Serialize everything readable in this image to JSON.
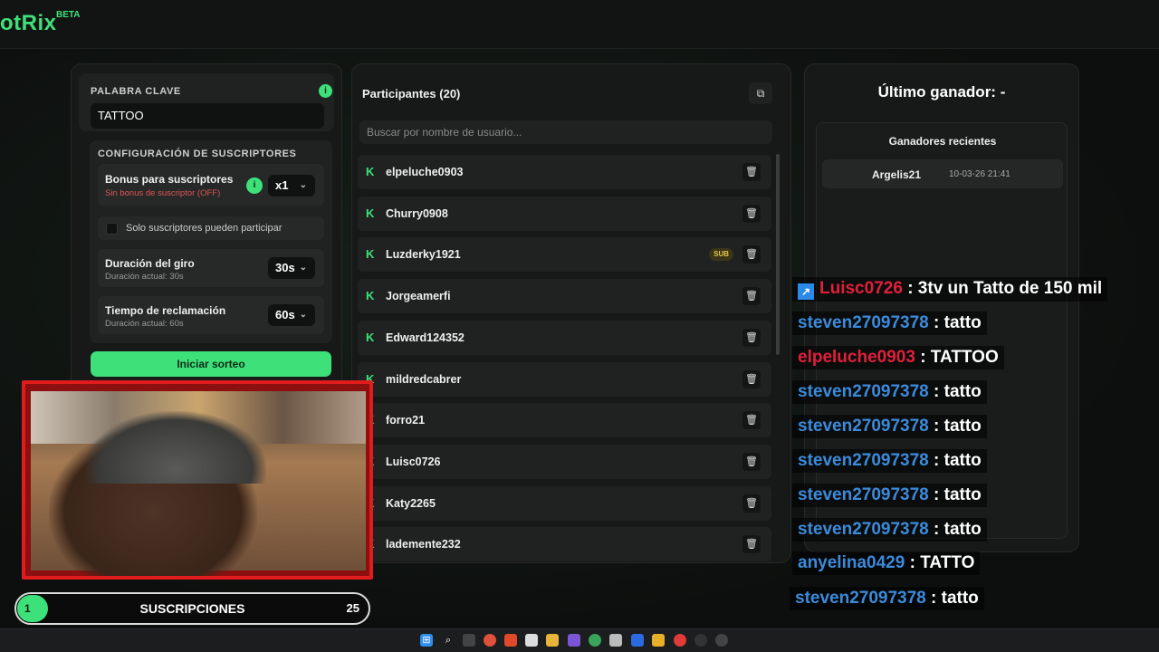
{
  "app": {
    "brand": "otRix",
    "badge": "BETA"
  },
  "keyword": {
    "label": "PALABRA CLAVE",
    "value": "TATTOO"
  },
  "subs_config": {
    "header": "CONFIGURACIÓN DE SUSCRIPTORES",
    "bonus_title": "Bonus para suscriptores",
    "bonus_sub": "Sin bonus de suscriptor (OFF)",
    "bonus_value": "x1",
    "only_subs": "Solo suscriptores pueden participar",
    "spin_title": "Duración del giro",
    "spin_sub": "Duración actual: 30s",
    "spin_value": "30s",
    "claim_title": "Tiempo de reclamación",
    "claim_sub": "Duración actual: 60s",
    "claim_value": "60s"
  },
  "start_button": "Iniciar sorteo",
  "participants": {
    "title": "Participantes (20)",
    "search_placeholder": "Buscar por nombre de usuario...",
    "sub_badge": "SUB",
    "items": [
      {
        "name": "elpeluche0903"
      },
      {
        "name": "Churry0908"
      },
      {
        "name": "Luzderky1921",
        "sub": true
      },
      {
        "name": "Jorgeamerfi"
      },
      {
        "name": "Edward124352"
      },
      {
        "name": "mildredcabrer"
      },
      {
        "name": "forro21"
      },
      {
        "name": "Luisc0726"
      },
      {
        "name": "Katy2265"
      },
      {
        "name": "lademente232"
      }
    ]
  },
  "winners": {
    "last_winner": "Último ganador: -",
    "recent_title": "Ganadores recientes",
    "recent": [
      {
        "name": "Argelis21",
        "date": "10-03-26 21:41"
      }
    ]
  },
  "chat": [
    {
      "user": "Luisc0726",
      "color": "#e0203a",
      "msg": ": 3tv un Tatto de 150 mil",
      "badge": true
    },
    {
      "user": "steven27097378",
      "color": "#3b8bdc",
      "msg": ": tatto"
    },
    {
      "user": "elpeluche0903",
      "color": "#e0203a",
      "msg": ": TATTOO"
    },
    {
      "user": "steven27097378",
      "color": "#3b8bdc",
      "msg": ": tatto"
    },
    {
      "user": "steven27097378",
      "color": "#3b8bdc",
      "msg": ": tatto"
    },
    {
      "user": "steven27097378",
      "color": "#3b8bdc",
      "msg": ": tatto"
    },
    {
      "user": "steven27097378",
      "color": "#3b8bdc",
      "msg": ": tatto"
    },
    {
      "user": "steven27097378",
      "color": "#3b8bdc",
      "msg": ": tatto"
    },
    {
      "user": "anyelina0429",
      "color": "#3b8bdc",
      "msg": ": TATTO"
    },
    {
      "user": "steven27097378",
      "color": "#3b8bdc",
      "msg": ": tatto"
    }
  ],
  "subs_goal": {
    "current": "1",
    "label": "SUSCRIPCIONES",
    "goal": "25",
    "progress_fraction": 0.04
  },
  "colors": {
    "accent": "#3ee07a",
    "cam_frame": "#e01c1c"
  }
}
